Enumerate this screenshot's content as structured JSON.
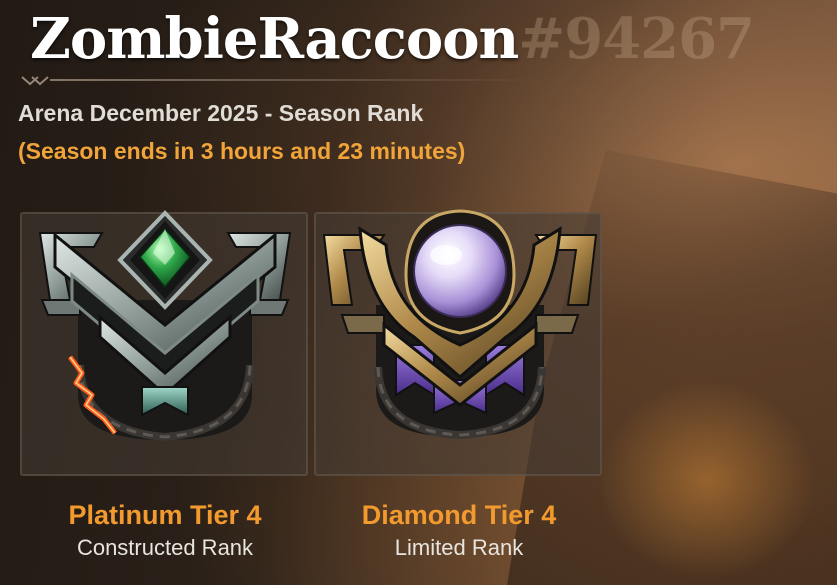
{
  "player": {
    "name": "ZombieRaccoon",
    "tag": "#94267"
  },
  "season": {
    "title": "Arena December 2025 - Season Rank",
    "ends": "(Season ends in 3 hours and 23 minutes)"
  },
  "ranks": [
    {
      "tier": "Platinum Tier 4",
      "format": "Constructed Rank",
      "badge_icon": "platinum-rank-emblem-icon",
      "gem_color": "#2fa84a"
    },
    {
      "tier": "Diamond Tier 4",
      "format": "Limited Rank",
      "badge_icon": "diamond-rank-emblem-icon",
      "gem_color": "#cbb8ef"
    }
  ],
  "colors": {
    "tier_text": "#f39a2e",
    "season_ends_text": "#f0a43a",
    "progress_pip": "#ff5a1a"
  }
}
